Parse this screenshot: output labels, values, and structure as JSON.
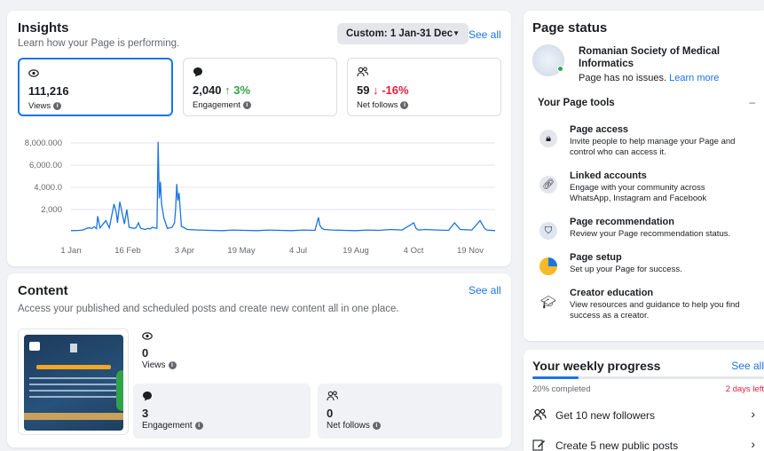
{
  "insights": {
    "title": "Insights",
    "subtitle": "Learn how your Page is performing.",
    "date_range": "Custom: 1 Jan-31 Dec",
    "see_all": "See all",
    "metrics": [
      {
        "icon": "eye-icon",
        "value": "111,216",
        "change": "",
        "label": "Views"
      },
      {
        "icon": "chat-bubble-icon",
        "value": "2,040",
        "change": "↑ 3%",
        "label": "Engagement"
      },
      {
        "icon": "people-icon",
        "value": "59",
        "change": "↓ -16%",
        "label": "Net follows"
      }
    ]
  },
  "chart_data": {
    "type": "line",
    "title": "",
    "xlabel": "",
    "ylabel": "",
    "y_ticks": [
      "8,000.000",
      "6,000.00",
      "4,000.0",
      "2,000"
    ],
    "x_ticks": [
      "1 Jan",
      "16 Feb",
      "3 Apr",
      "19 May",
      "4 Jul",
      "19 Aug",
      "4 Oct",
      "19 Nov"
    ],
    "ylim": [
      0,
      8000
    ],
    "grid": true,
    "series": [
      {
        "color": "#1b74e4",
        "x": [
          0,
          7,
          10,
          15,
          18,
          20,
          22,
          23,
          25,
          30,
          33,
          37,
          39,
          40,
          42,
          46,
          48,
          50,
          52,
          54,
          56,
          58,
          60,
          62,
          64,
          66,
          68,
          70,
          72,
          74,
          75,
          76,
          77,
          78,
          80,
          83,
          87,
          89,
          90,
          91,
          92,
          93,
          95,
          100,
          110,
          120,
          130,
          140,
          150,
          160,
          170,
          180,
          190,
          200,
          210,
          213,
          214,
          216,
          218,
          225,
          235,
          245,
          255,
          265,
          275,
          285,
          295,
          297,
          299,
          305,
          315,
          325,
          330,
          335,
          345,
          352,
          356,
          358,
          365
        ],
        "y": [
          100,
          120,
          150,
          350,
          300,
          450,
          280,
          1400,
          350,
          1000,
          350,
          2500,
          1700,
          800,
          2700,
          700,
          2000,
          400,
          350,
          300,
          350,
          800,
          300,
          250,
          200,
          300,
          250,
          400,
          350,
          300,
          8100,
          3000,
          4500,
          2500,
          1200,
          300,
          400,
          800,
          2000,
          4300,
          2800,
          3500,
          500,
          200,
          150,
          120,
          100,
          150,
          120,
          100,
          150,
          120,
          100,
          150,
          120,
          1300,
          600,
          300,
          200,
          150,
          120,
          100,
          150,
          120,
          200,
          150,
          800,
          300,
          150,
          200,
          150,
          120,
          800,
          200,
          150,
          1000,
          300,
          150,
          100
        ]
      }
    ]
  },
  "content": {
    "title": "Content",
    "see_all": "See all",
    "subtitle": "Access your published and scheduled posts and create new content all in one place.",
    "views": {
      "icon": "eye-icon",
      "value": "0",
      "label": "Views"
    },
    "engagement": {
      "icon": "chat-bubble-icon",
      "value": "3",
      "label": "Engagement"
    },
    "net_follows": {
      "icon": "people-icon",
      "value": "0",
      "label": "Net follows"
    }
  },
  "page_status": {
    "title": "Page status",
    "page_name_line1": "Romanian Society of Medical",
    "page_name_line2": "Informatics",
    "status_text": "Page has no issues.",
    "learn_more": "Learn more",
    "tools_header": "Your Page tools",
    "collapse": "–",
    "tools": [
      {
        "icon": "lock-icon",
        "title": "Page access",
        "desc": "Invite people to help manage your Page and control who can access it."
      },
      {
        "icon": "link-icon",
        "title": "Linked accounts",
        "desc": "Engage with your community across WhatsApp, Instagram and Facebook"
      },
      {
        "icon": "shield-icon",
        "title": "Page recommendation",
        "desc": "Review your Page recommendation status."
      },
      {
        "icon": "pie-chart-icon",
        "title": "Page setup",
        "desc": "Set up your Page for success."
      },
      {
        "icon": "graduation-cap-icon",
        "title": "Creator education",
        "desc": "View resources and guidance to help you find success as a creator."
      }
    ]
  },
  "weekly": {
    "title": "Your weekly progress",
    "see_all": "See all",
    "completed": "20% completed",
    "progress": 0.2,
    "days_left": "2 days left",
    "tasks": [
      "Get 10 new followers",
      "Create 5 new public posts"
    ]
  }
}
